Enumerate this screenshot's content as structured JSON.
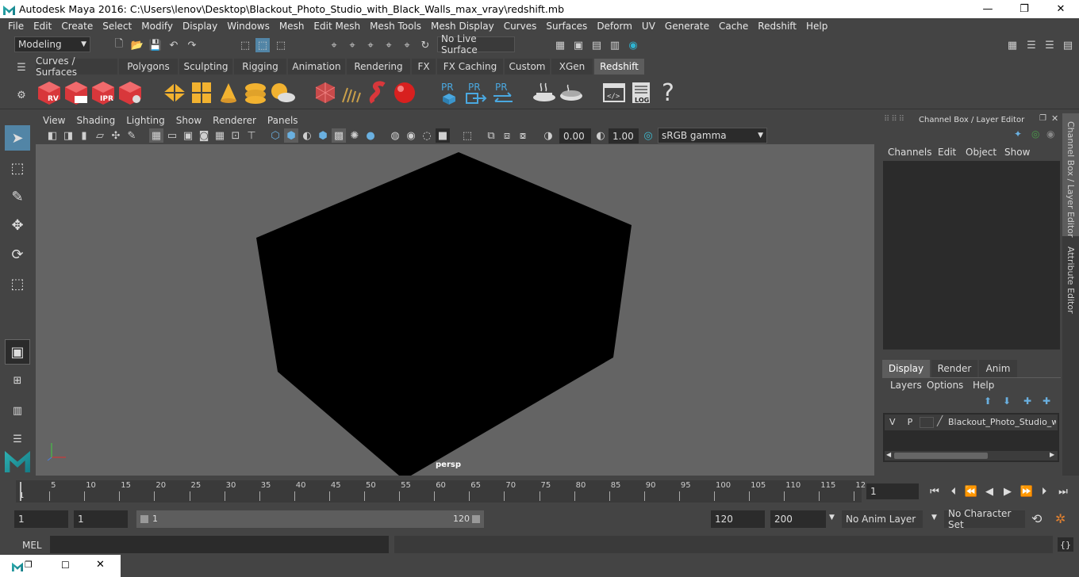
{
  "window": {
    "title": "Autodesk Maya 2016: C:\\Users\\lenov\\Desktop\\Blackout_Photo_Studio_with_Black_Walls_max_vray\\redshift.mb",
    "minimize_glyph": "—",
    "maximize_glyph": "❐",
    "close_glyph": "✕"
  },
  "menubar": [
    "File",
    "Edit",
    "Create",
    "Select",
    "Modify",
    "Display",
    "Windows",
    "Mesh",
    "Edit Mesh",
    "Mesh Tools",
    "Mesh Display",
    "Curves",
    "Surfaces",
    "Deform",
    "UV",
    "Generate",
    "Cache",
    "Redshift",
    "Help"
  ],
  "statusline": {
    "mode": "Modeling",
    "live_surface": "No Live Surface"
  },
  "shelf_tabs": [
    {
      "label": "Curves / Surfaces",
      "active": false
    },
    {
      "label": "Polygons",
      "active": false
    },
    {
      "label": "Sculpting",
      "active": false
    },
    {
      "label": "Rigging",
      "active": false
    },
    {
      "label": "Animation",
      "active": false
    },
    {
      "label": "Rendering",
      "active": false
    },
    {
      "label": "FX",
      "active": false
    },
    {
      "label": "FX Caching",
      "active": false
    },
    {
      "label": "Custom",
      "active": false
    },
    {
      "label": "XGen",
      "active": false
    },
    {
      "label": "Redshift",
      "active": true
    }
  ],
  "shelf_icons": {
    "rv": "RV",
    "ipr": "IPR",
    "pr": "PR",
    "log": "LOG",
    "help": "?"
  },
  "viewport": {
    "menu": [
      "View",
      "Shading",
      "Lighting",
      "Show",
      "Renderer",
      "Panels"
    ],
    "exposure": "0.00",
    "gamma": "1.00",
    "color_space": "sRGB gamma",
    "camera_label": "persp",
    "cube_color": "#000000",
    "background": "#646464"
  },
  "channel_box": {
    "title": "Channel Box / Layer Editor",
    "menu": [
      "Channels",
      "Edit",
      "Object",
      "Show"
    ],
    "layer_tabs": [
      "Display",
      "Render",
      "Anim"
    ],
    "layer_menu": [
      "Layers",
      "Options",
      "Help"
    ],
    "layer_row": {
      "v": "V",
      "p": "P",
      "name": "Blackout_Photo_Studio_w"
    }
  },
  "side_tabs": [
    "Channel Box / Layer Editor",
    "Attribute Editor"
  ],
  "timeline": {
    "ticks": [
      "5",
      "10",
      "15",
      "20",
      "25",
      "30",
      "35",
      "40",
      "45",
      "50",
      "55",
      "60",
      "65",
      "70",
      "75",
      "80",
      "85",
      "90",
      "95",
      "100",
      "105",
      "110",
      "115",
      "12"
    ],
    "start_marker": "1",
    "current_frame": "1"
  },
  "range": {
    "start": "1",
    "playback_start": "1",
    "slider_start": "1",
    "slider_end": "120",
    "playback_end": "120",
    "end": "200",
    "anim_layer": "No Anim Layer",
    "character_set": "No Character Set"
  },
  "command_line": {
    "label": "MEL"
  }
}
